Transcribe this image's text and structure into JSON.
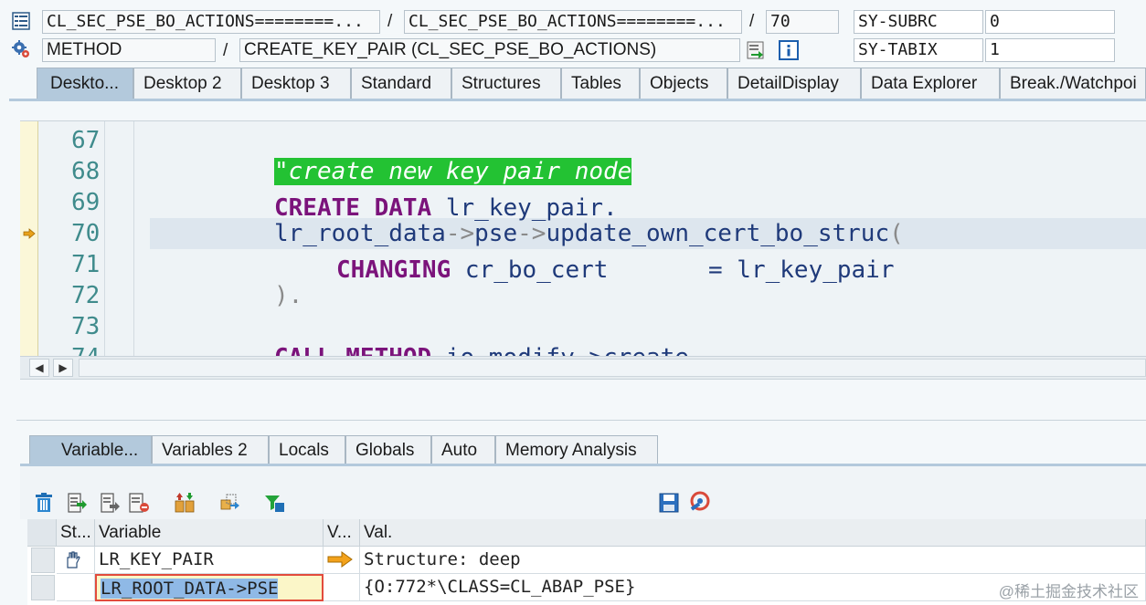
{
  "header": {
    "program_field": "CL_SEC_PSE_BO_ACTIONS========...",
    "include_field": "CL_SEC_PSE_BO_ACTIONS========...",
    "line_field": "70",
    "event_type_field": "METHOD",
    "event_name_field": "CREATE_KEY_PAIR (CL_SEC_PSE_BO_ACTIONS)",
    "sysvar1_name": "SY-SUBRC",
    "sysvar1_value": "0",
    "sysvar2_name": "SY-TABIX",
    "sysvar2_value": "1",
    "separator": "/"
  },
  "desktop_tabs": [
    {
      "label": "Deskto...",
      "active": true
    },
    {
      "label": "Desktop 2",
      "active": false
    },
    {
      "label": "Desktop 3",
      "active": false
    },
    {
      "label": "Standard",
      "active": false
    },
    {
      "label": "Structures",
      "active": false
    },
    {
      "label": "Tables",
      "active": false
    },
    {
      "label": "Objects",
      "active": false
    },
    {
      "label": "DetailDisplay",
      "active": false
    },
    {
      "label": "Data Explorer",
      "active": false
    },
    {
      "label": "Break./Watchpoi",
      "active": false
    }
  ],
  "editor": {
    "line_numbers": [
      "67",
      "68",
      "69",
      "70",
      "71",
      "72",
      "73",
      "74"
    ],
    "current_line": "70",
    "comment": "\"create new key pair node",
    "create_data_kw": "CREATE DATA",
    "create_data_arg": " lr_key_pair.",
    "call_obj": "lr_root_data",
    "arrow1": "->",
    "call_mid": "pse",
    "arrow2": "->",
    "call_method": "update_own_cert_bo_struc",
    "paren_open": "(",
    "changing_kw": "CHANGING",
    "param_name": " cr_bo_cert",
    "param_eq": "       = lr_key_pair",
    "close_stmt": ").",
    "line74_kw": "CALL METHOD",
    "line74_rest": " io_modify->create"
  },
  "variable_tabs": [
    {
      "label": "Variable...",
      "active": true
    },
    {
      "label": "Variables 2",
      "active": false
    },
    {
      "label": "Locals",
      "active": false
    },
    {
      "label": "Globals",
      "active": false
    },
    {
      "label": "Auto",
      "active": false
    },
    {
      "label": "Memory Analysis",
      "active": false
    }
  ],
  "grid": {
    "headers": {
      "status": "St...",
      "variable": "Variable",
      "value_type": "V...",
      "value": "Val."
    },
    "rows": [
      {
        "variable": "LR_KEY_PAIR",
        "value": "Structure: deep"
      },
      {
        "variable": "LR_ROOT_DATA->PSE",
        "value": "{O:772*\\CLASS=CL_ABAP_PSE}"
      }
    ]
  },
  "watermark": "@稀土掘金技术社区",
  "colors": {
    "comment_bg": "#23c233",
    "keyword": "#7b137b",
    "code_text": "#1f3a7a",
    "active_tab": "#b3c9dc",
    "selection_border": "#e24b3c"
  }
}
